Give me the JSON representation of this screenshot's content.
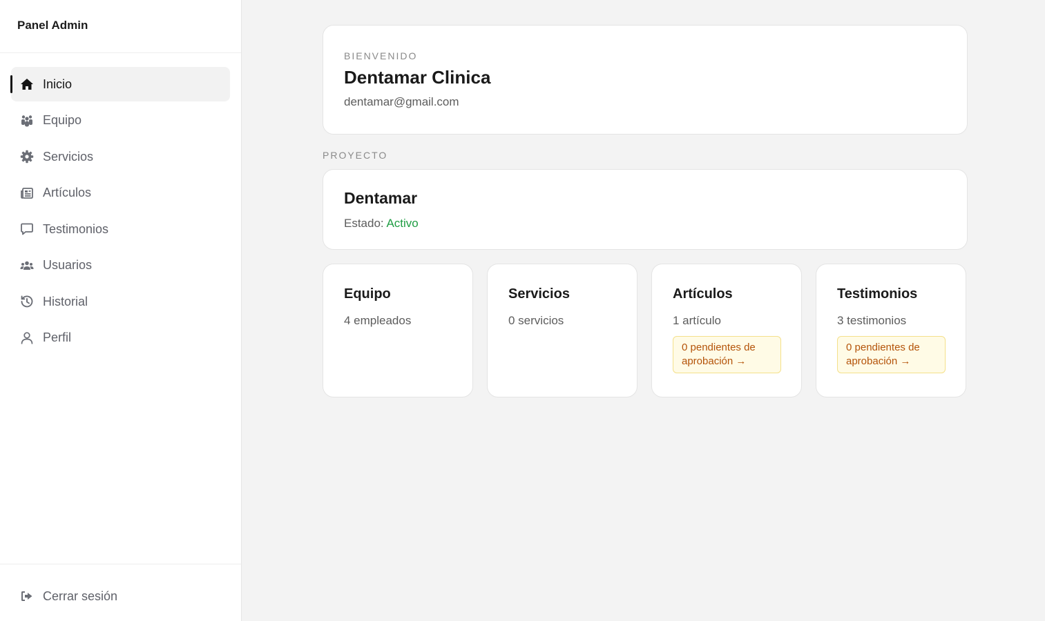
{
  "sidebar": {
    "brand": "Panel Admin",
    "items": [
      {
        "label": "Inicio",
        "icon": "home-icon",
        "active": true
      },
      {
        "label": "Equipo",
        "icon": "team-icon"
      },
      {
        "label": "Servicios",
        "icon": "gear-icon"
      },
      {
        "label": "Artículos",
        "icon": "newspaper-icon"
      },
      {
        "label": "Testimonios",
        "icon": "comment-icon"
      },
      {
        "label": "Usuarios",
        "icon": "users-icon"
      },
      {
        "label": "Historial",
        "icon": "history-icon"
      },
      {
        "label": "Perfil",
        "icon": "user-icon"
      }
    ],
    "logout": {
      "label": "Cerrar sesión",
      "icon": "logout-icon"
    }
  },
  "welcome": {
    "eyebrow": "BIENVENIDO",
    "name": "Dentamar Clinica",
    "email": "dentamar@gmail.com"
  },
  "project": {
    "section_label": "PROYECTO",
    "name": "Dentamar",
    "status_label": "Estado:",
    "status_value": "Activo"
  },
  "stats": [
    {
      "title": "Equipo",
      "value": "4 empleados"
    },
    {
      "title": "Servicios",
      "value": "0 servicios"
    },
    {
      "title": "Artículos",
      "value": "1 artículo",
      "pending": "0 pendientes de aprobación →"
    },
    {
      "title": "Testimonios",
      "value": "3 testimonios",
      "pending": "0 pendientes de aprobación →"
    }
  ],
  "colors": {
    "accent": "#141414",
    "status_active": "#1f9d43",
    "pending_text": "#b45309",
    "pending_bg": "#fffbe6"
  }
}
